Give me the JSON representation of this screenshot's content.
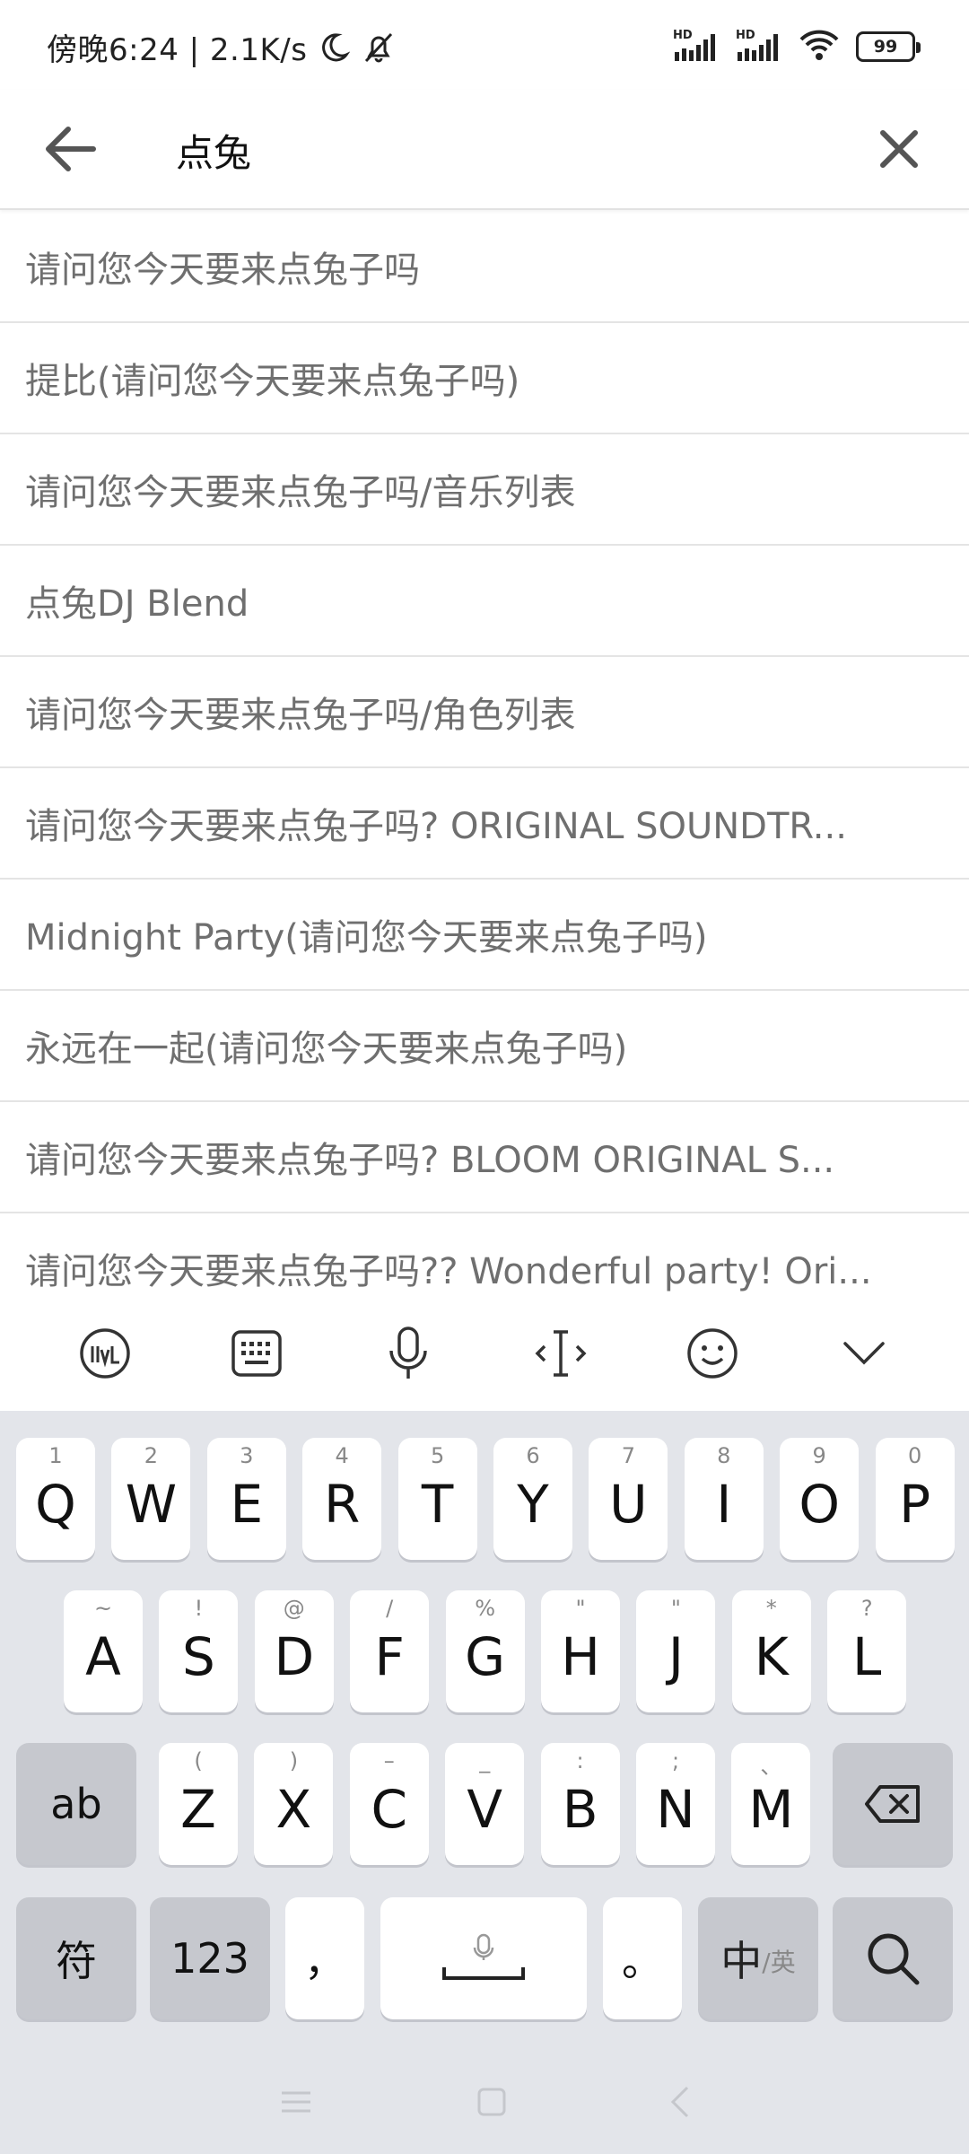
{
  "status": {
    "time_text": "傍晚6:24 | 2.1K/s",
    "battery": "99",
    "signal_hd_1": "HD",
    "signal_hd_2": "HD"
  },
  "search": {
    "query": "点兔"
  },
  "suggestions": [
    "请问您今天要来点兔子吗",
    "提比(请问您今天要来点兔子吗)",
    "请问您今天要来点兔子吗/音乐列表",
    "点兔DJ Blend",
    "请问您今天要来点兔子吗/角色列表",
    "请问您今天要来点兔子吗? ORIGINAL SOUNDTR...",
    "Midnight Party(请问您今天要来点兔子吗)",
    "永远在一起(请问您今天要来点兔子吗)",
    "请问您今天要来点兔子吗?  BLOOM ORIGINAL S...",
    "请问您今天要来点兔子吗?? Wonderful party! Ori..."
  ],
  "keyboard": {
    "row1": [
      {
        "key": "Q",
        "hint": "1"
      },
      {
        "key": "W",
        "hint": "2"
      },
      {
        "key": "E",
        "hint": "3"
      },
      {
        "key": "R",
        "hint": "4"
      },
      {
        "key": "T",
        "hint": "5"
      },
      {
        "key": "Y",
        "hint": "6"
      },
      {
        "key": "U",
        "hint": "7"
      },
      {
        "key": "I",
        "hint": "8"
      },
      {
        "key": "O",
        "hint": "9"
      },
      {
        "key": "P",
        "hint": "0"
      }
    ],
    "row2": [
      {
        "key": "A",
        "hint": "~"
      },
      {
        "key": "S",
        "hint": "!"
      },
      {
        "key": "D",
        "hint": "@"
      },
      {
        "key": "F",
        "hint": "/"
      },
      {
        "key": "G",
        "hint": "%"
      },
      {
        "key": "H",
        "hint": "\""
      },
      {
        "key": "J",
        "hint": "\""
      },
      {
        "key": "K",
        "hint": "*"
      },
      {
        "key": "L",
        "hint": "?"
      }
    ],
    "row3": [
      {
        "key": "Z",
        "hint": "("
      },
      {
        "key": "X",
        "hint": ")"
      },
      {
        "key": "C",
        "hint": "–"
      },
      {
        "key": "V",
        "hint": "_"
      },
      {
        "key": "B",
        "hint": ":"
      },
      {
        "key": "N",
        "hint": ";"
      },
      {
        "key": "M",
        "hint": "、"
      }
    ],
    "shift_label": "ab",
    "symbols_label": "符",
    "numbers_label": "123",
    "comma_label": "，",
    "period_label": "。",
    "lang_main": "中",
    "lang_sub": "/英"
  }
}
